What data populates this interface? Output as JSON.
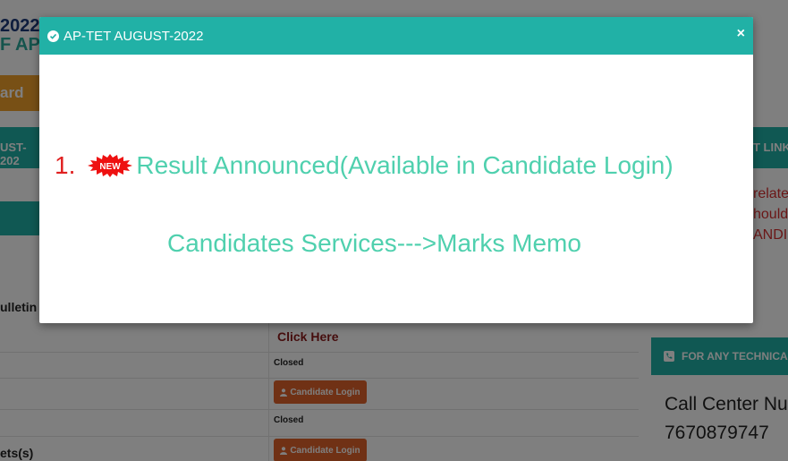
{
  "background": {
    "header_year": "2022",
    "header_ap": "F AP",
    "nav_tab": "ard",
    "left_tab": "UST-202",
    "bulletin": "ulletin",
    "sheets": "ets(s)",
    "click_here": "Click Here",
    "rows": [
      {
        "status": "Closed",
        "button": "Candidate Login"
      },
      {
        "status": "Closed",
        "button": "Candidate Login"
      }
    ],
    "right_tab": "T LINK",
    "right_red_lines": [
      "relate",
      "hould",
      "ANDID"
    ],
    "tech_bar": "FOR ANY TECHNICA",
    "call_center": "Call Center Nu",
    "call_number": "7670879747"
  },
  "modal": {
    "title": "AP-TET AUGUST-2022",
    "close": "×",
    "item_number": "1.",
    "new_badge": "NEW",
    "line1": "Result Announced(Available in Candidate Login)",
    "line2": "Candidates Services--->Marks Memo"
  },
  "colors": {
    "teal": "#21b1a6",
    "announce_text": "#4fd0ae",
    "number_red": "#e02020",
    "button_orange": "#e0622a"
  },
  "icons": {
    "title_icon": "check-circle-icon",
    "close_icon": "close-icon",
    "button_icon": "user-icon",
    "tech_icon": "phone-icon"
  }
}
